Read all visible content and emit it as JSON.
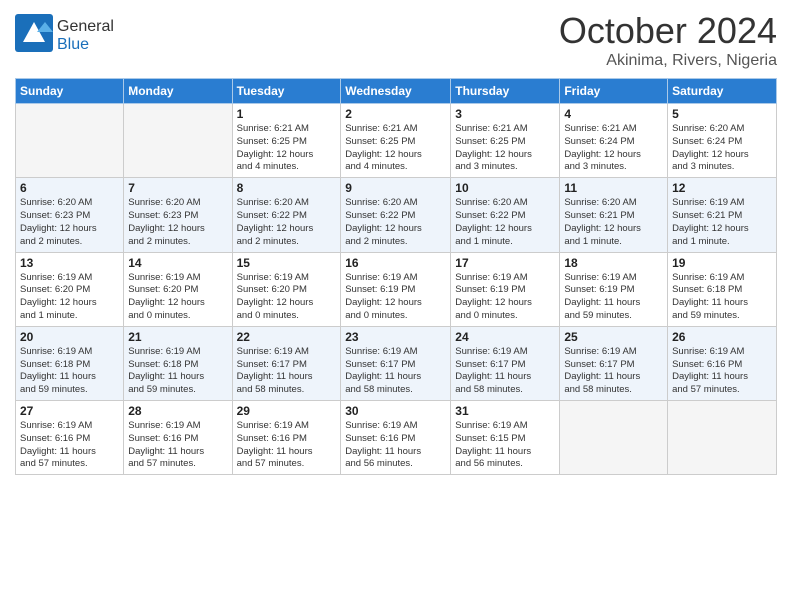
{
  "logo": {
    "general": "General",
    "blue": "Blue"
  },
  "header": {
    "title": "October 2024",
    "subtitle": "Akinima, Rivers, Nigeria"
  },
  "weekdays": [
    "Sunday",
    "Monday",
    "Tuesday",
    "Wednesday",
    "Thursday",
    "Friday",
    "Saturday"
  ],
  "weeks": [
    [
      {
        "day": "",
        "info": ""
      },
      {
        "day": "",
        "info": ""
      },
      {
        "day": "1",
        "info": "Sunrise: 6:21 AM\nSunset: 6:25 PM\nDaylight: 12 hours\nand 4 minutes."
      },
      {
        "day": "2",
        "info": "Sunrise: 6:21 AM\nSunset: 6:25 PM\nDaylight: 12 hours\nand 4 minutes."
      },
      {
        "day": "3",
        "info": "Sunrise: 6:21 AM\nSunset: 6:25 PM\nDaylight: 12 hours\nand 3 minutes."
      },
      {
        "day": "4",
        "info": "Sunrise: 6:21 AM\nSunset: 6:24 PM\nDaylight: 12 hours\nand 3 minutes."
      },
      {
        "day": "5",
        "info": "Sunrise: 6:20 AM\nSunset: 6:24 PM\nDaylight: 12 hours\nand 3 minutes."
      }
    ],
    [
      {
        "day": "6",
        "info": "Sunrise: 6:20 AM\nSunset: 6:23 PM\nDaylight: 12 hours\nand 2 minutes."
      },
      {
        "day": "7",
        "info": "Sunrise: 6:20 AM\nSunset: 6:23 PM\nDaylight: 12 hours\nand 2 minutes."
      },
      {
        "day": "8",
        "info": "Sunrise: 6:20 AM\nSunset: 6:22 PM\nDaylight: 12 hours\nand 2 minutes."
      },
      {
        "day": "9",
        "info": "Sunrise: 6:20 AM\nSunset: 6:22 PM\nDaylight: 12 hours\nand 2 minutes."
      },
      {
        "day": "10",
        "info": "Sunrise: 6:20 AM\nSunset: 6:22 PM\nDaylight: 12 hours\nand 1 minute."
      },
      {
        "day": "11",
        "info": "Sunrise: 6:20 AM\nSunset: 6:21 PM\nDaylight: 12 hours\nand 1 minute."
      },
      {
        "day": "12",
        "info": "Sunrise: 6:19 AM\nSunset: 6:21 PM\nDaylight: 12 hours\nand 1 minute."
      }
    ],
    [
      {
        "day": "13",
        "info": "Sunrise: 6:19 AM\nSunset: 6:20 PM\nDaylight: 12 hours\nand 1 minute."
      },
      {
        "day": "14",
        "info": "Sunrise: 6:19 AM\nSunset: 6:20 PM\nDaylight: 12 hours\nand 0 minutes."
      },
      {
        "day": "15",
        "info": "Sunrise: 6:19 AM\nSunset: 6:20 PM\nDaylight: 12 hours\nand 0 minutes."
      },
      {
        "day": "16",
        "info": "Sunrise: 6:19 AM\nSunset: 6:19 PM\nDaylight: 12 hours\nand 0 minutes."
      },
      {
        "day": "17",
        "info": "Sunrise: 6:19 AM\nSunset: 6:19 PM\nDaylight: 12 hours\nand 0 minutes."
      },
      {
        "day": "18",
        "info": "Sunrise: 6:19 AM\nSunset: 6:19 PM\nDaylight: 11 hours\nand 59 minutes."
      },
      {
        "day": "19",
        "info": "Sunrise: 6:19 AM\nSunset: 6:18 PM\nDaylight: 11 hours\nand 59 minutes."
      }
    ],
    [
      {
        "day": "20",
        "info": "Sunrise: 6:19 AM\nSunset: 6:18 PM\nDaylight: 11 hours\nand 59 minutes."
      },
      {
        "day": "21",
        "info": "Sunrise: 6:19 AM\nSunset: 6:18 PM\nDaylight: 11 hours\nand 59 minutes."
      },
      {
        "day": "22",
        "info": "Sunrise: 6:19 AM\nSunset: 6:17 PM\nDaylight: 11 hours\nand 58 minutes."
      },
      {
        "day": "23",
        "info": "Sunrise: 6:19 AM\nSunset: 6:17 PM\nDaylight: 11 hours\nand 58 minutes."
      },
      {
        "day": "24",
        "info": "Sunrise: 6:19 AM\nSunset: 6:17 PM\nDaylight: 11 hours\nand 58 minutes."
      },
      {
        "day": "25",
        "info": "Sunrise: 6:19 AM\nSunset: 6:17 PM\nDaylight: 11 hours\nand 58 minutes."
      },
      {
        "day": "26",
        "info": "Sunrise: 6:19 AM\nSunset: 6:16 PM\nDaylight: 11 hours\nand 57 minutes."
      }
    ],
    [
      {
        "day": "27",
        "info": "Sunrise: 6:19 AM\nSunset: 6:16 PM\nDaylight: 11 hours\nand 57 minutes."
      },
      {
        "day": "28",
        "info": "Sunrise: 6:19 AM\nSunset: 6:16 PM\nDaylight: 11 hours\nand 57 minutes."
      },
      {
        "day": "29",
        "info": "Sunrise: 6:19 AM\nSunset: 6:16 PM\nDaylight: 11 hours\nand 57 minutes."
      },
      {
        "day": "30",
        "info": "Sunrise: 6:19 AM\nSunset: 6:16 PM\nDaylight: 11 hours\nand 56 minutes."
      },
      {
        "day": "31",
        "info": "Sunrise: 6:19 AM\nSunset: 6:15 PM\nDaylight: 11 hours\nand 56 minutes."
      },
      {
        "day": "",
        "info": ""
      },
      {
        "day": "",
        "info": ""
      }
    ]
  ]
}
